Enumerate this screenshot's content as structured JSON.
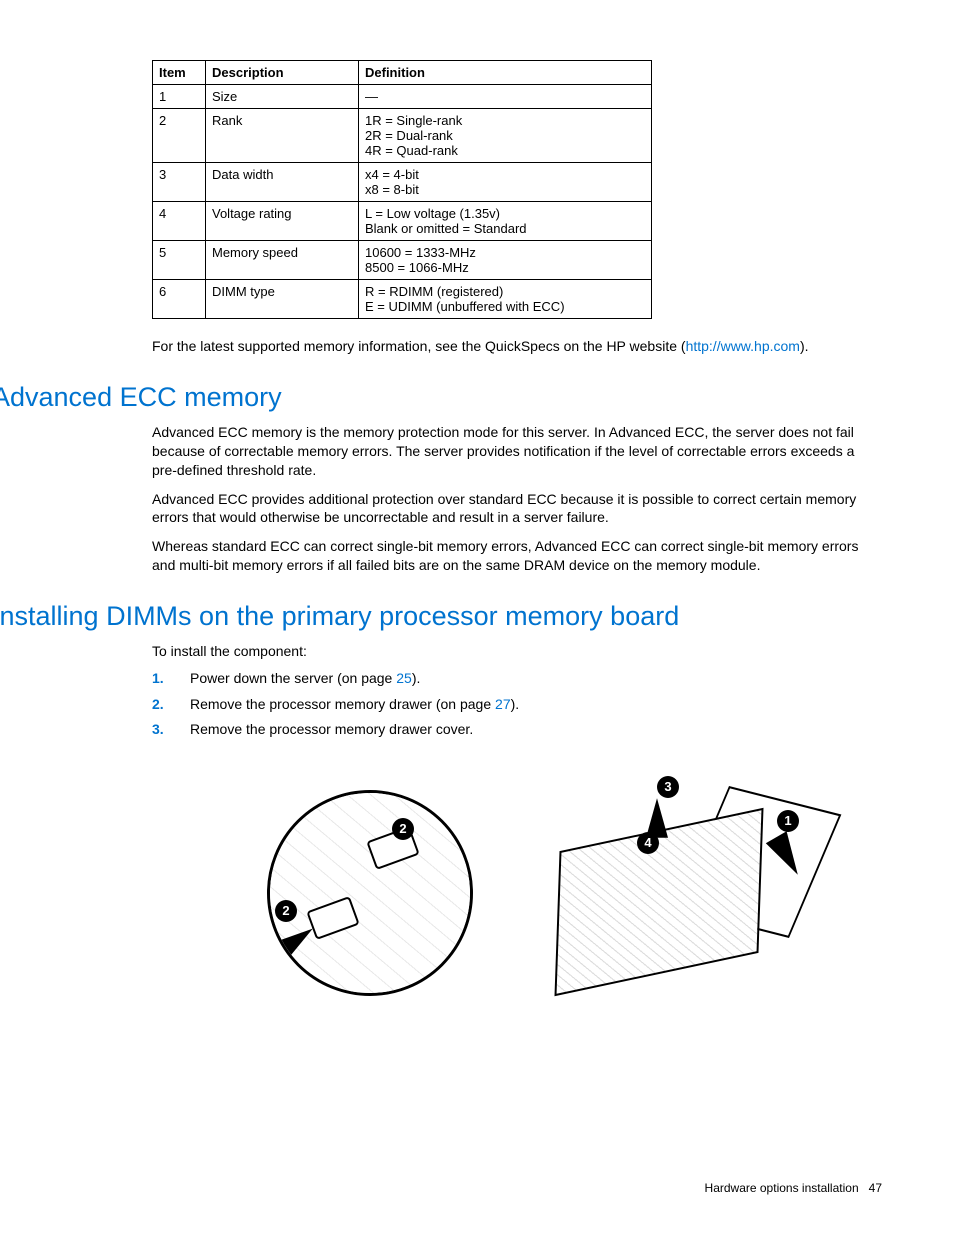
{
  "table": {
    "headers": [
      "Item",
      "Description",
      "Definition"
    ],
    "rows": [
      {
        "item": "1",
        "desc": "Size",
        "def": "—"
      },
      {
        "item": "2",
        "desc": "Rank",
        "def": "1R = Single-rank\n2R = Dual-rank\n4R = Quad-rank"
      },
      {
        "item": "3",
        "desc": "Data width",
        "def": "x4 = 4-bit\nx8 = 8-bit"
      },
      {
        "item": "4",
        "desc": "Voltage rating",
        "def": "L = Low voltage (1.35v)\nBlank or omitted = Standard"
      },
      {
        "item": "5",
        "desc": "Memory speed",
        "def": "10600 = 1333-MHz\n8500 = 1066-MHz"
      },
      {
        "item": "6",
        "desc": "DIMM type",
        "def": "R = RDIMM (registered)\nE = UDIMM (unbuffered with ECC)"
      }
    ]
  },
  "quickspecs": {
    "pre": "For the latest supported memory information, see the QuickSpecs on the HP website (",
    "link_text": "http://www.hp.com",
    "link_href": "http://www.hp.com",
    "post": ")."
  },
  "section1": {
    "heading": "Advanced ECC memory",
    "p1": "Advanced ECC memory is the memory protection mode for this server. In Advanced ECC, the server does not fail because of correctable memory errors. The server provides notification if the level of correctable errors exceeds a pre-defined threshold rate.",
    "p2": "Advanced ECC provides additional protection over standard ECC because it is possible to correct certain memory errors that would otherwise be uncorrectable and result in a server failure.",
    "p3": "Whereas standard ECC can correct single-bit memory errors, Advanced ECC can correct single-bit memory errors and multi-bit memory errors if all failed bits are on the same DRAM device on the memory module."
  },
  "section2": {
    "heading": "Installing DIMMs on the primary processor memory board",
    "intro": "To install the component:",
    "steps": [
      {
        "pre": "Power down the server (on page ",
        "link": "25",
        "post": ")."
      },
      {
        "pre": "Remove the processor memory drawer (on page ",
        "link": "27",
        "post": ")."
      },
      {
        "pre": "Remove the processor memory drawer cover.",
        "link": "",
        "post": ""
      }
    ]
  },
  "figure": {
    "callouts": [
      "1",
      "2",
      "2",
      "3",
      "4"
    ]
  },
  "footer": {
    "section": "Hardware options installation",
    "page": "47"
  }
}
